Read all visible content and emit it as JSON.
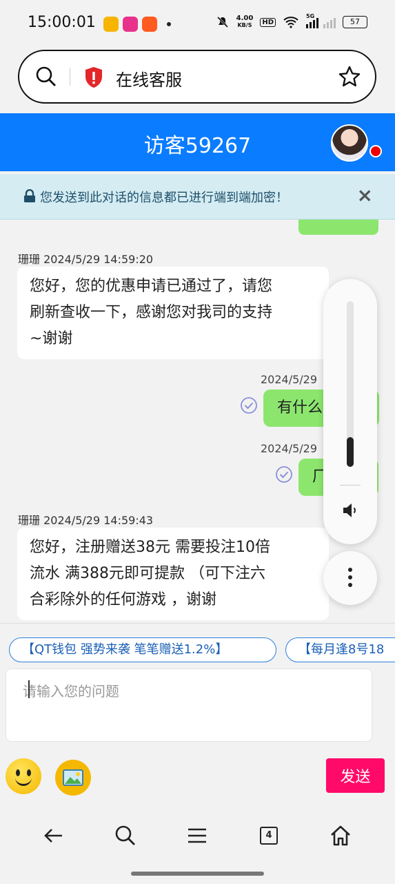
{
  "status_bar": {
    "time": "15:00:01",
    "network_speed": "4.00",
    "network_speed_unit": "KB/S",
    "hd_badge": "HD",
    "signal_label": "5G",
    "battery": "57"
  },
  "browser": {
    "page_title": "在线客服"
  },
  "chat": {
    "title": "访客59267",
    "notice": "您发送到此对话的信息都已进行端到端加密！",
    "messages": [
      {
        "side": "left",
        "sender_time": "珊珊 2024/5/29 14:59:20",
        "lines": [
          "您好，您的优惠申请已通过了，请您",
          "刷新查收一下，感谢您对我司的支持",
          "~谢谢"
        ]
      },
      {
        "side": "right",
        "time": "2024/5/29",
        "text": "有什么"
      },
      {
        "side": "right",
        "time": "2024/5/29",
        "text": "厂"
      },
      {
        "side": "left",
        "sender_time": "珊珊 2024/5/29 14:59:43",
        "lines": [
          "您好，注册赠送38元 需要投注10倍",
          "流水 满388元即可提款 （可下注六",
          "合彩除外的任何游戏 ，谢谢"
        ]
      }
    ]
  },
  "promos": [
    "【QT钱包 强势来袭 笔笔赠送1.2%】",
    "【每月逢8号18"
  ],
  "input": {
    "placeholder": "请输入您的问题"
  },
  "actions": {
    "send_label": "发送"
  },
  "volume": {
    "level_fraction": 0.18
  },
  "bottom_nav": {
    "tab_count": "4"
  },
  "colors": {
    "header_blue": "#0a7cff",
    "bubble_green": "#8ce66e",
    "send_pink": "#ff0a68",
    "notice_bg": "#d4ecf2"
  }
}
